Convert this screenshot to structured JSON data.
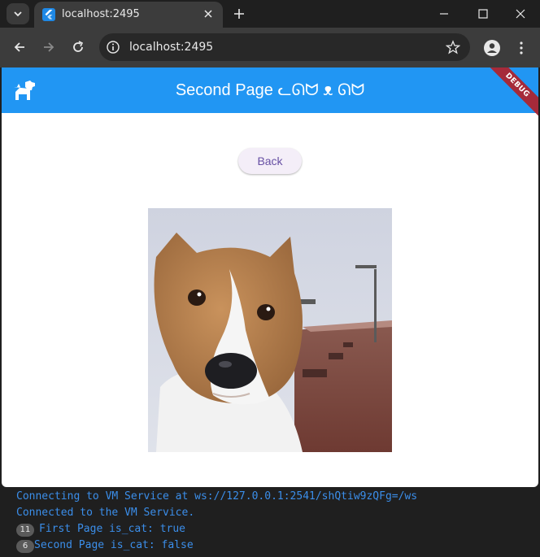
{
  "browser": {
    "tab_title": "localhost:2495",
    "url": "localhost:2495"
  },
  "app": {
    "title": "Second Page ᓚᘏᗢ ᴥ ᘏᗢ",
    "debug_label": "DEBUG",
    "back_label": "Back",
    "image_subject": "corgi-dog-photo",
    "colors": {
      "appbar": "#2196f3",
      "button_text": "#6750a4",
      "button_bg": "#f4eef8"
    }
  },
  "console": {
    "lines": [
      {
        "text": "Connecting to VM Service at ws://127.0.0.1:2541/shQtiw9zQFg=/ws"
      },
      {
        "text": "Connected to the VM Service."
      },
      {
        "badge": "11",
        "text": "First Page is_cat: true"
      },
      {
        "badge": "6",
        "text": "Second Page is_cat: false"
      }
    ]
  }
}
